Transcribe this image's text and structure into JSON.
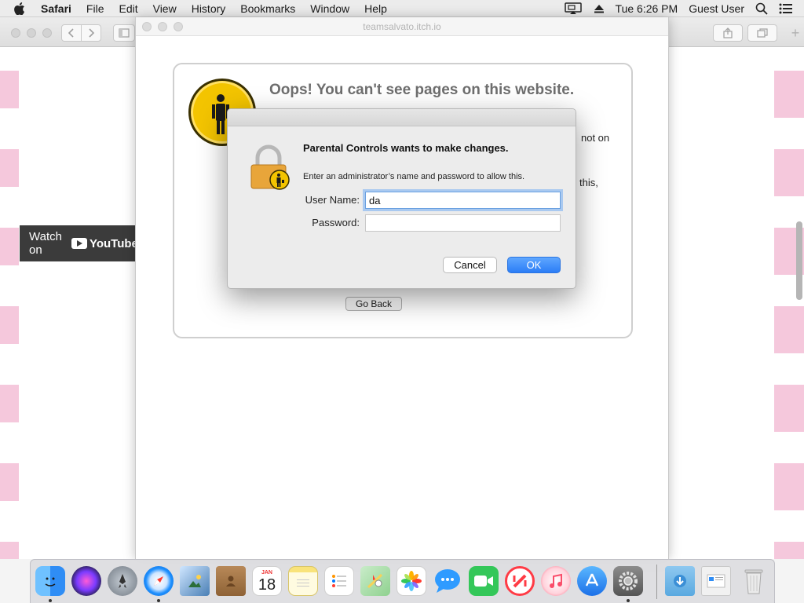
{
  "menubar": {
    "apple": "apple-logo-icon",
    "items": [
      "Safari",
      "File",
      "Edit",
      "View",
      "History",
      "Bookmarks",
      "Window",
      "Help"
    ],
    "clock": "Tue 6:26 PM",
    "user": "Guest User"
  },
  "front_window": {
    "url": "teamsalvato.itch.io",
    "headline": "Oops! You can't see pages on this website.",
    "text_fragment_1": "not on",
    "text_fragment_2": "this,",
    "go_back": "Go Back"
  },
  "background_window": {
    "video_label": "Watch on",
    "video_brand": "YouTube"
  },
  "dialog": {
    "title": "Parental Controls wants to make changes.",
    "message": "Enter an administrator’s name and password to allow this.",
    "username_label": "User Name:",
    "username_value": "da",
    "password_label": "Password:",
    "password_value": "",
    "cancel": "Cancel",
    "ok": "OK"
  },
  "dock": {
    "apps": [
      {
        "name": "Finder",
        "icon": "finder-icon",
        "color": "#2f8df5",
        "running": true
      },
      {
        "name": "Siri",
        "icon": "siri-icon",
        "color": "#6a3bd6",
        "running": false
      },
      {
        "name": "Launchpad",
        "icon": "launchpad-icon",
        "color": "#9aa0a8",
        "running": false
      },
      {
        "name": "Safari",
        "icon": "safari-icon",
        "color": "#1e90ff",
        "running": true
      },
      {
        "name": "Preview",
        "icon": "preview-icon",
        "color": "#4a7fb5",
        "running": false
      },
      {
        "name": "Contacts",
        "icon": "contacts-icon",
        "color": "#a67a4b",
        "running": false
      },
      {
        "name": "Calendar",
        "icon": "calendar-icon",
        "color": "#ffffff",
        "running": false
      },
      {
        "name": "Notes",
        "icon": "notes-icon",
        "color": "#f9e37a",
        "running": false
      },
      {
        "name": "Reminders",
        "icon": "reminders-icon",
        "color": "#ffffff",
        "running": false
      },
      {
        "name": "Maps",
        "icon": "maps-icon",
        "color": "#8fd18f",
        "running": false
      },
      {
        "name": "Photos",
        "icon": "photos-icon",
        "color": "#ffffff",
        "running": false
      },
      {
        "name": "Messages",
        "icon": "messages-icon",
        "color": "#2f9bff",
        "running": false
      },
      {
        "name": "FaceTime",
        "icon": "facetime-icon",
        "color": "#34c759",
        "running": false
      },
      {
        "name": "News",
        "icon": "news-icon",
        "color": "#ff3b45",
        "running": false
      },
      {
        "name": "Music",
        "icon": "music-icon",
        "color": "#fa4d6a",
        "running": false
      },
      {
        "name": "App Store",
        "icon": "app-store-icon",
        "color": "#1c8cf3",
        "running": false
      },
      {
        "name": "System Preferences",
        "icon": "system-preferences-icon",
        "color": "#777777",
        "running": true
      }
    ],
    "calendar_month": "JAN",
    "calendar_day": "18"
  }
}
